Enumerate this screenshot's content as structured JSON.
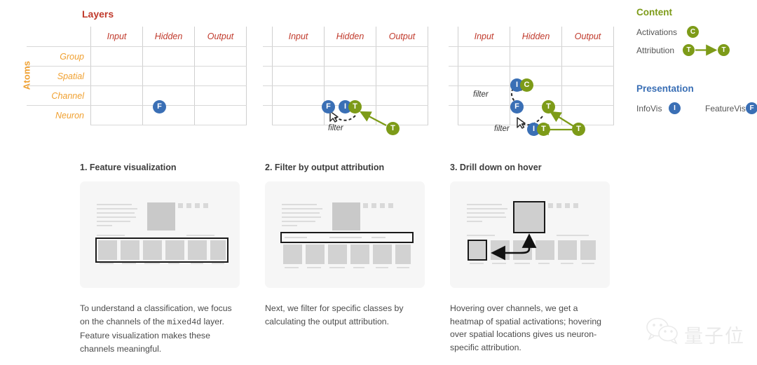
{
  "axes": {
    "rows_axis_label": "Atoms",
    "cols_axis_label": "Layers",
    "column_headers": [
      "Input",
      "Hidden",
      "Output"
    ],
    "row_headers": [
      "Group",
      "Spatial",
      "Channel",
      "Neuron"
    ]
  },
  "diagrams": [
    {
      "name": "feature-visualization-grid",
      "badges": [
        {
          "letter": "F",
          "kind": "blue",
          "row": "Channel",
          "col": "Hidden"
        }
      ],
      "filter_labels": [],
      "arrows": []
    },
    {
      "name": "filter-by-output-attribution-grid",
      "badges": [
        {
          "letter": "F",
          "kind": "blue",
          "row": "Channel",
          "col": "Hidden"
        },
        {
          "letter": "I",
          "kind": "blue",
          "row": "Channel",
          "col": "Hidden"
        },
        {
          "letter": "T",
          "kind": "green",
          "row": "Channel",
          "col": "Hidden"
        },
        {
          "letter": "T",
          "kind": "green",
          "row": "Neuron",
          "col": "Output"
        }
      ],
      "filter_labels": [
        "filter"
      ],
      "arrows": [
        {
          "style": "solid-green",
          "from": "output-T",
          "to": "hidden-T"
        },
        {
          "style": "dashed-cursor",
          "from": "hidden-T",
          "to": "filter-cursor"
        }
      ]
    },
    {
      "name": "drill-down-on-hover-grid",
      "badges": [
        {
          "letter": "I",
          "kind": "blue",
          "row": "Spatial",
          "col": "Hidden"
        },
        {
          "letter": "C",
          "kind": "green",
          "row": "Spatial",
          "col": "Hidden"
        },
        {
          "letter": "F",
          "kind": "blue",
          "row": "Channel",
          "col": "Hidden"
        },
        {
          "letter": "T",
          "kind": "green",
          "row": "Channel",
          "col": "Hidden"
        },
        {
          "letter": "I",
          "kind": "blue",
          "row": "Neuron",
          "col": "Hidden"
        },
        {
          "letter": "T",
          "kind": "green",
          "row": "Neuron",
          "col": "Hidden"
        },
        {
          "letter": "T",
          "kind": "green",
          "row": "Neuron",
          "col": "Output"
        }
      ],
      "filter_labels": [
        "filter",
        "filter"
      ],
      "arrows": [
        {
          "style": "solid-green",
          "from": "output-T",
          "to": "channel-T"
        },
        {
          "style": "solid-green",
          "from": "output-T",
          "to": "neuron-T"
        },
        {
          "style": "dashed-cursor",
          "from": "channel-F",
          "to": "upper-filter-cursor"
        },
        {
          "style": "dashed-cursor",
          "from": "neuron-I",
          "to": "lower-filter-cursor"
        }
      ]
    }
  ],
  "legend": {
    "content": {
      "heading": "Content",
      "items": [
        {
          "label": "Activations",
          "glyph": "C",
          "kind": "green",
          "has_arrow": false
        },
        {
          "label": "Attribution",
          "glyph": "T",
          "kind": "green",
          "has_arrow": true,
          "glyph2": "T"
        }
      ]
    },
    "presentation": {
      "heading": "Presentation",
      "items": [
        {
          "label": "InfoVis",
          "glyph": "I",
          "kind": "blue"
        },
        {
          "label": "FeatureVis",
          "glyph": "F",
          "kind": "blue"
        }
      ]
    }
  },
  "panels": [
    {
      "title": "1. Feature visualization",
      "caption_parts": [
        {
          "text": "To understand a classification, we focus on the channels of the ",
          "mono": false
        },
        {
          "text": "mixed4d",
          "mono": true
        },
        {
          "text": " layer. Feature visualization makes these channels meaningful.",
          "mono": false
        }
      ],
      "thumb_highlight": "filmstrip-row"
    },
    {
      "title": "2. Filter by output attribution",
      "caption_parts": [
        {
          "text": "Next, we filter for specific classes by calculating the output attribution.",
          "mono": false
        }
      ],
      "thumb_highlight": "filter-bar"
    },
    {
      "title": "3. Drill down on hover",
      "caption_parts": [
        {
          "text": "Hovering over channels, we get a heatmap of spatial activations; hovering over spatial locations gives us neuron-specific attribution.",
          "mono": false
        }
      ],
      "thumb_highlight": "zoom-callout"
    }
  ],
  "watermark": {
    "text": "量子位",
    "icon": "wechat-icon"
  },
  "colors": {
    "layers_red": "#c0392b",
    "atoms_orange": "#f0a030",
    "infovis_blue": "#3a6fb5",
    "content_green": "#7d9b18",
    "grid_line": "#d8d8d8",
    "caption_gray": "#4b4b4b"
  }
}
